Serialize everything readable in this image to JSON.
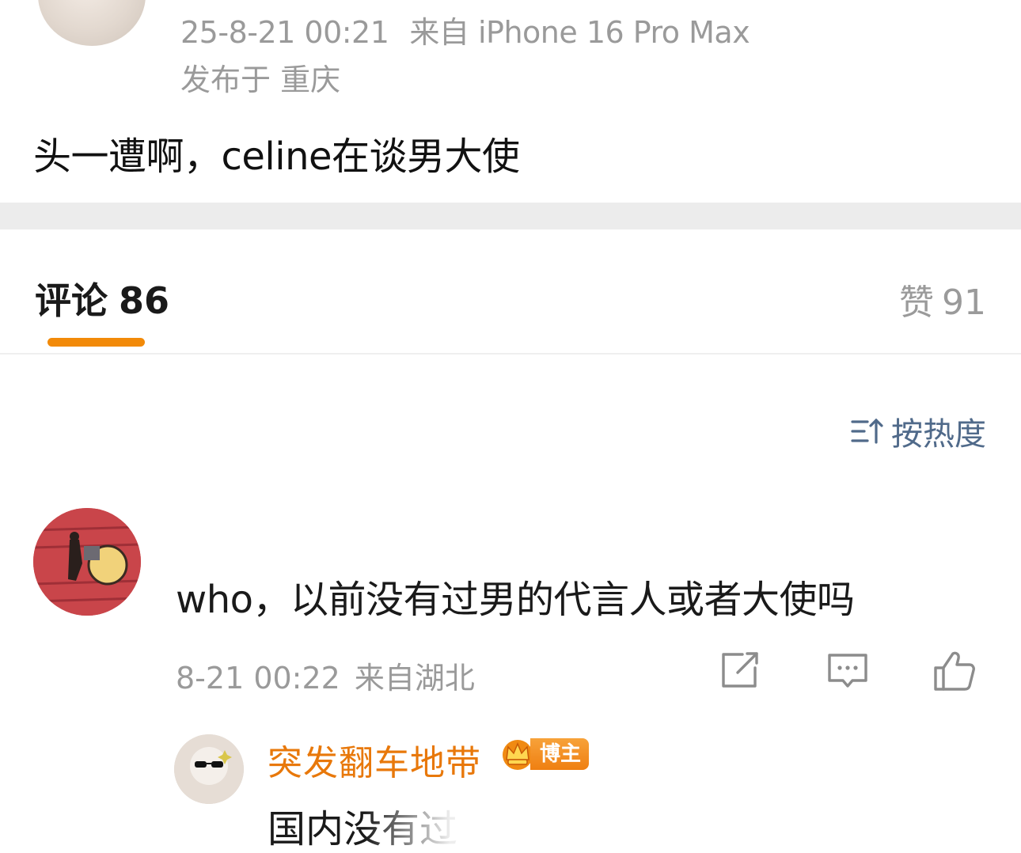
{
  "post": {
    "timestamp": "25-8-21 00:21",
    "source": "来自 iPhone 16 Pro Max",
    "location": "发布于 重庆",
    "text": "头一遭啊，celine在谈男大使"
  },
  "tabs": {
    "comments_label": "评论",
    "comments_count": "86",
    "likes_label": "赞",
    "likes_count": "91"
  },
  "sort": {
    "icon": "sort-icon",
    "label": "按热度"
  },
  "comment": {
    "text": "who，以前没有过男的代言人或者大使吗",
    "time": "8-21 00:22",
    "location": "来自湖北",
    "actions": [
      "share-icon",
      "comment-icon",
      "like-icon"
    ]
  },
  "reply": {
    "username": "突发翻车地带",
    "badge": "博主",
    "text": "国内没有过"
  },
  "colors": {
    "accent_orange": "#f28a09",
    "username_orange": "#e8780a",
    "sort_blue": "#506a8a",
    "meta_gray": "#9a9a9a"
  }
}
